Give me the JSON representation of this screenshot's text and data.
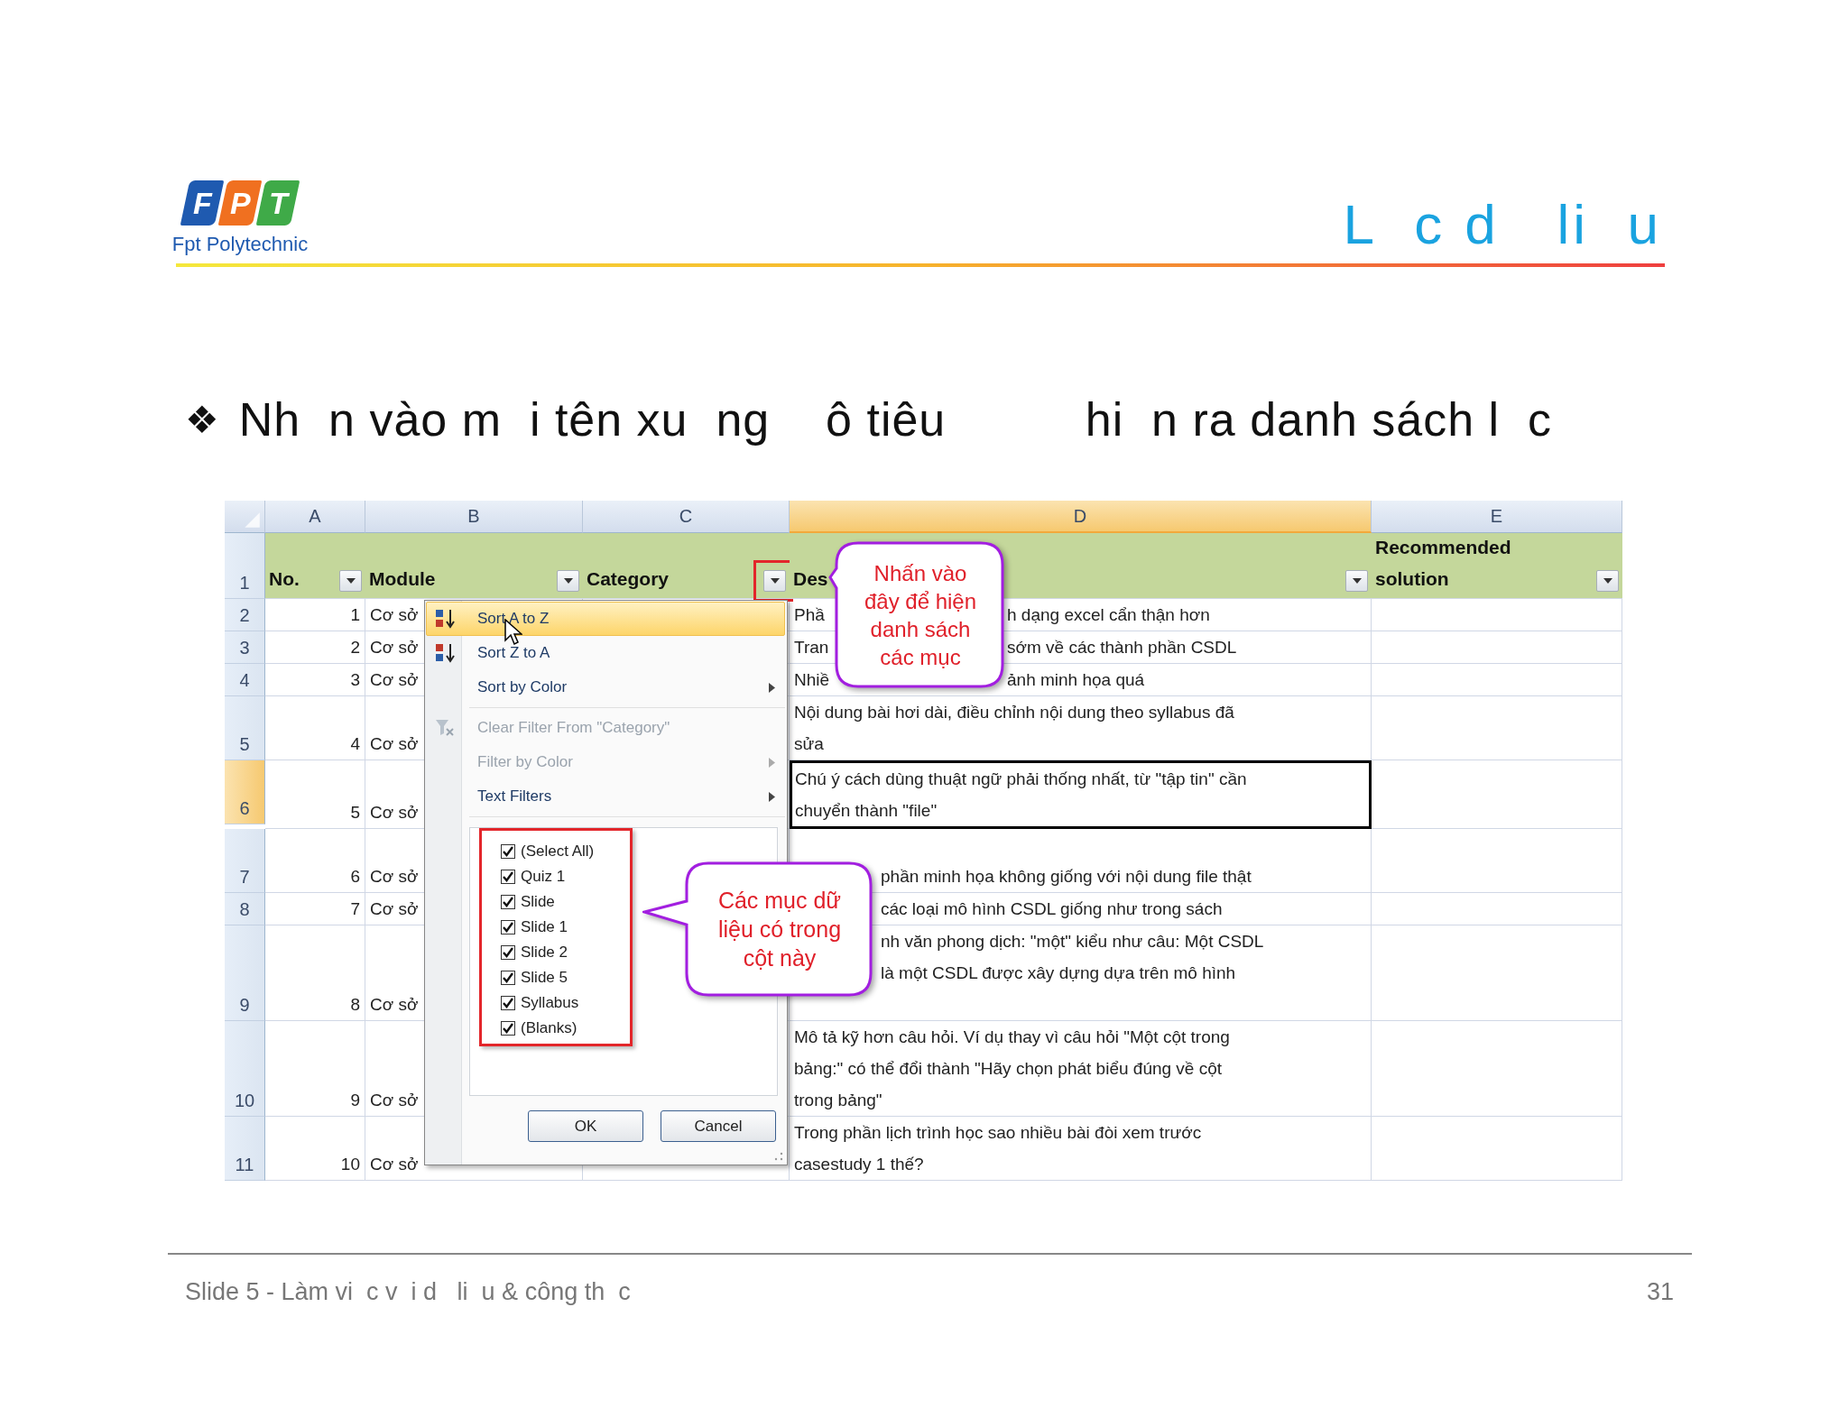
{
  "logo": {
    "tiles": [
      {
        "letter": "F",
        "color": "#1f5ab0"
      },
      {
        "letter": "P",
        "color": "#f07020"
      },
      {
        "letter": "T",
        "color": "#3faa48"
      }
    ],
    "name": "Fpt Polytechnic"
  },
  "title": "L  c d   li  u",
  "bullet": {
    "symbol": "❖",
    "text": "Nh  n vào m  i tên xu  ng    ô tiêu          hi  n ra danh sách l  c"
  },
  "sheet": {
    "columns": [
      {
        "label": "A",
        "selected": false
      },
      {
        "label": "B",
        "selected": false
      },
      {
        "label": "C",
        "selected": false
      },
      {
        "label": "D",
        "selected": true
      },
      {
        "label": "E",
        "selected": false
      }
    ],
    "header_row": {
      "row": "1",
      "cells": [
        {
          "lines": [
            "No."
          ],
          "highlighted": false
        },
        {
          "lines": [
            "Module"
          ],
          "highlighted": false
        },
        {
          "lines": [
            "Category"
          ],
          "highlighted": true
        },
        {
          "lines": [
            "Des"
          ],
          "highlighted": false
        },
        {
          "lines": [
            "Recommended",
            "solution"
          ],
          "highlighted": false
        }
      ]
    },
    "rows": [
      {
        "row": "2",
        "selected": false,
        "no": "1",
        "module": "Cơ sở",
        "description": [
          {
            "text": "Phầ",
            "rest": "h dạng excel cẩn thận hơn"
          }
        ]
      },
      {
        "row": "3",
        "selected": false,
        "no": "2",
        "module": "Cơ sở",
        "description": [
          {
            "text": "Tran",
            "rest": "sớm về các thành phần CSDL"
          }
        ]
      },
      {
        "row": "4",
        "selected": false,
        "no": "3",
        "module": "Cơ sở",
        "description": [
          {
            "text": "Nhiề",
            "rest": "ảnh minh họa quá"
          }
        ]
      },
      {
        "row": "5",
        "selected": false,
        "no": "4",
        "module": "Cơ sở",
        "description": [
          {
            "text": "Nội dung bài hơi dài, điều chỉnh nội dung theo syllabus đã"
          },
          {
            "text": "sửa"
          }
        ]
      },
      {
        "row": "6",
        "selected": true,
        "no": "5",
        "module": "Cơ sở",
        "description": [
          {
            "text": "Chú ý cách dùng thuật ngữ phải thống nhất, từ \"tập tin\" cần"
          },
          {
            "text": "chuyển thành \"file\""
          }
        ]
      },
      {
        "row": "7",
        "selected": false,
        "no": "6",
        "module": "Cơ sở",
        "description": [
          {
            "rest": "phần minh họa không giống với nội dung file thật"
          }
        ]
      },
      {
        "row": "8",
        "selected": false,
        "no": "7",
        "module": "Cơ sở",
        "description": [
          {
            "rest": "các loại mô hình CSDL giống như trong sách"
          }
        ]
      },
      {
        "row": "9",
        "selected": false,
        "no": "8",
        "module": "Cơ sở",
        "description": [
          {
            "rest": "nh văn phong dịch: \"một\" kiểu như câu:  Một CSDL"
          },
          {
            "rest": "là một CSDL được xây dựng dựa trên mô hình"
          }
        ]
      },
      {
        "row": "10",
        "selected": false,
        "no": "9",
        "module": "Cơ sở",
        "description": [
          {
            "text": "Mô tả kỹ hơn câu hỏi. Ví dụ thay vì câu hỏi \"Một cột trong"
          },
          {
            "text": "bảng:\" có thể đổi thành \"Hãy chọn phát biểu đúng về cột"
          },
          {
            "text": "trong bảng\""
          }
        ]
      },
      {
        "row": "11",
        "selected": false,
        "no": "10",
        "module": "Cơ sở",
        "description": [
          {
            "text": "Trong phần lịch trình học sao nhiều bài đòi xem trước"
          },
          {
            "text": "casestudy 1 thế?"
          }
        ]
      }
    ],
    "filter_menu": {
      "sections": [
        {
          "items": [
            {
              "label": "Sort A to Z",
              "kind": "sort-ascending",
              "highlighted": true,
              "disabled": false,
              "submenu": false
            },
            {
              "label": "Sort Z to A",
              "kind": "sort-descending",
              "highlighted": false,
              "disabled": false,
              "submenu": false
            },
            {
              "label": "Sort by Color",
              "kind": "plain",
              "highlighted": false,
              "disabled": false,
              "submenu": true
            }
          ]
        },
        {
          "items": [
            {
              "label": "Clear Filter From \"Category\"",
              "kind": "clear-filter",
              "highlighted": false,
              "disabled": true,
              "submenu": false
            },
            {
              "label": "Filter by Color",
              "kind": "plain",
              "highlighted": false,
              "disabled": true,
              "submenu": true
            },
            {
              "label": "Text Filters",
              "kind": "plain",
              "highlighted": false,
              "disabled": false,
              "submenu": true
            }
          ]
        }
      ],
      "values": [
        {
          "label": "(Select All)",
          "checked": true
        },
        {
          "label": "Quiz 1",
          "checked": true
        },
        {
          "label": "Slide",
          "checked": true
        },
        {
          "label": "Slide 1",
          "checked": true
        },
        {
          "label": "Slide 2",
          "checked": true
        },
        {
          "label": "Slide 5",
          "checked": true
        },
        {
          "label": "Syllabus",
          "checked": true
        },
        {
          "label": "(Blanks)",
          "checked": true
        }
      ],
      "buttons": [
        "OK",
        "Cancel"
      ]
    },
    "callouts": [
      {
        "lines": [
          "Nhấn vào",
          "đây để hiện",
          "danh sách",
          "các mục"
        ]
      },
      {
        "lines": [
          "Các mục dữ",
          "liệu có trong",
          "cột này"
        ]
      }
    ]
  },
  "footer": {
    "text": "Slide 5 - Làm vi  c v  i d   li  u & công th  c",
    "page": "31"
  }
}
